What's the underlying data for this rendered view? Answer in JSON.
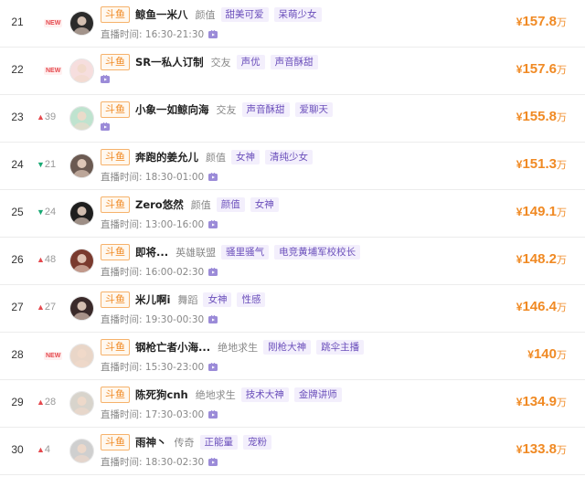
{
  "list_label": "直播时间:",
  "rows": [
    {
      "rank": "21",
      "change": {
        "type": "new",
        "text": "NEW"
      },
      "platform": "斗鱼",
      "name": "鲸鱼一米八",
      "category": "颜值",
      "tags": [
        "甜美可爱",
        "呆萌少女"
      ],
      "time": "16:30-21:30",
      "currency": "¥",
      "amount": "157.8",
      "unit": "万",
      "avatar_color": "#2b2b2b"
    },
    {
      "rank": "22",
      "change": {
        "type": "new",
        "text": "NEW"
      },
      "platform": "斗鱼",
      "name": "SR一私人订制",
      "category": "交友",
      "tags": [
        "声优",
        "声音酥甜"
      ],
      "time": "",
      "currency": "¥",
      "amount": "157.6",
      "unit": "万",
      "avatar_color": "#f6dede"
    },
    {
      "rank": "23",
      "change": {
        "type": "up",
        "text": "39"
      },
      "platform": "斗鱼",
      "name": "小象一如鲸向海",
      "category": "交友",
      "tags": [
        "声音酥甜",
        "爱聊天"
      ],
      "time": "",
      "currency": "¥",
      "amount": "155.8",
      "unit": "万",
      "avatar_color": "#bfe3cf"
    },
    {
      "rank": "24",
      "change": {
        "type": "down",
        "text": "21"
      },
      "platform": "斗鱼",
      "name": "奔跑的姜允儿",
      "category": "颜值",
      "tags": [
        "女神",
        "清纯少女"
      ],
      "time": "18:30-01:00",
      "currency": "¥",
      "amount": "151.3",
      "unit": "万",
      "avatar_color": "#6b5a52"
    },
    {
      "rank": "25",
      "change": {
        "type": "down",
        "text": "24"
      },
      "platform": "斗鱼",
      "name": "Zero悠然",
      "category": "颜值",
      "tags": [
        "颜值",
        "女神"
      ],
      "time": "13:00-16:00",
      "currency": "¥",
      "amount": "149.1",
      "unit": "万",
      "avatar_color": "#1e1e1e"
    },
    {
      "rank": "26",
      "change": {
        "type": "up",
        "text": "48"
      },
      "platform": "斗鱼",
      "name": "即将...",
      "category": "英雄联盟",
      "tags": [
        "骚里骚气",
        "电竞黄埔军校校长"
      ],
      "time": "16:00-02:30",
      "currency": "¥",
      "amount": "148.2",
      "unit": "万",
      "avatar_color": "#7a3a2e"
    },
    {
      "rank": "27",
      "change": {
        "type": "up",
        "text": "27"
      },
      "platform": "斗鱼",
      "name": "米儿啊i",
      "category": "舞蹈",
      "tags": [
        "女神",
        "性感"
      ],
      "time": "19:30-00:30",
      "currency": "¥",
      "amount": "146.4",
      "unit": "万",
      "avatar_color": "#3a2a2a"
    },
    {
      "rank": "28",
      "change": {
        "type": "new",
        "text": "NEW"
      },
      "platform": "斗鱼",
      "name": "钢枪亡者小海...",
      "category": "绝地求生",
      "tags": [
        "刚枪大神",
        "跳伞主播"
      ],
      "time": "15:30-23:00",
      "currency": "¥",
      "amount": "140",
      "unit": "万",
      "avatar_color": "#e9d6c8"
    },
    {
      "rank": "29",
      "change": {
        "type": "up",
        "text": "28"
      },
      "platform": "斗鱼",
      "name": "陈死狗cnh",
      "category": "绝地求生",
      "tags": [
        "技术大神",
        "金牌讲师"
      ],
      "time": "17:30-03:00",
      "currency": "¥",
      "amount": "134.9",
      "unit": "万",
      "avatar_color": "#d8d4cc"
    },
    {
      "rank": "30",
      "change": {
        "type": "up",
        "text": "4"
      },
      "platform": "斗鱼",
      "name": "雨神丶",
      "category": "传奇",
      "tags": [
        "正能量",
        "宠粉"
      ],
      "time": "18:30-02:30",
      "currency": "¥",
      "amount": "133.8",
      "unit": "万",
      "avatar_color": "#cfcfcf"
    }
  ]
}
